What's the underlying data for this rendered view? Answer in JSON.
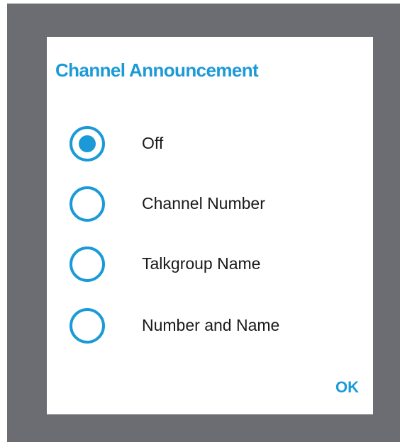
{
  "dialog": {
    "title": "Channel Announcement",
    "options": [
      {
        "label": "Off",
        "selected": true
      },
      {
        "label": "Channel Number",
        "selected": false
      },
      {
        "label": "Talkgroup Name",
        "selected": false
      },
      {
        "label": "Number and Name",
        "selected": false
      }
    ],
    "ok_label": "OK"
  },
  "colors": {
    "accent": "#1b9ad7",
    "backdrop": "#6b6d72",
    "dialog_background": "#ffffff",
    "text": "#1a1a1a"
  }
}
